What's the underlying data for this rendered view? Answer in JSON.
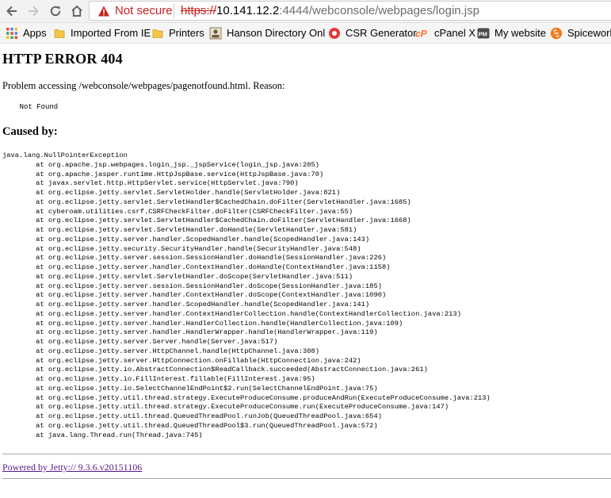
{
  "browser": {
    "security_label": "Not secure",
    "url": {
      "scheme": "https://",
      "host": "10.141.12.2",
      "rest": ":4444/webconsole/webpages/login.jsp"
    },
    "bookmarks": [
      {
        "label": "Apps",
        "icon": "apps-grid-icon"
      },
      {
        "label": "Imported From IE",
        "icon": "folder-icon"
      },
      {
        "label": "Printers",
        "icon": "folder-icon"
      },
      {
        "label": "Hanson Directory Onl",
        "icon": "directory-site-icon"
      },
      {
        "label": "CSR Generator",
        "icon": "csr-site-icon"
      },
      {
        "label": "cPanel X",
        "icon": "cpanel-icon"
      },
      {
        "label": "My website",
        "icon": "pm-site-icon"
      },
      {
        "label": "Spicework",
        "icon": "spiceworks-icon"
      }
    ]
  },
  "page": {
    "title": "HTTP ERROR 404",
    "problem": "Problem accessing /webconsole/webpages/pagenotfound.html. Reason:",
    "reason": "    Not Found",
    "caused_by": "Caused by:",
    "exception": "java.lang.NullPointerException",
    "stack": [
      "at org.apache.jsp.webpages.login_jsp._jspService(login_jsp.java:205)",
      "at org.apache.jasper.runtime.HttpJspBase.service(HttpJspBase.java:70)",
      "at javax.servlet.http.HttpServlet.service(HttpServlet.java:790)",
      "at org.eclipse.jetty.servlet.ServletHolder.handle(ServletHolder.java:821)",
      "at org.eclipse.jetty.servlet.ServletHandler$CachedChain.doFilter(ServletHandler.java:1685)",
      "at cyberoam.utilities.csrf.CSRFCheckFilter.doFilter(CSRFCheckFilter.java:55)",
      "at org.eclipse.jetty.servlet.ServletHandler$CachedChain.doFilter(ServletHandler.java:1668)",
      "at org.eclipse.jetty.servlet.ServletHandler.doHandle(ServletHandler.java:581)",
      "at org.eclipse.jetty.server.handler.ScopedHandler.handle(ScopedHandler.java:143)",
      "at org.eclipse.jetty.security.SecurityHandler.handle(SecurityHandler.java:548)",
      "at org.eclipse.jetty.server.session.SessionHandler.doHandle(SessionHandler.java:226)",
      "at org.eclipse.jetty.server.handler.ContextHandler.doHandle(ContextHandler.java:1158)",
      "at org.eclipse.jetty.servlet.ServletHandler.doScope(ServletHandler.java:511)",
      "at org.eclipse.jetty.server.session.SessionHandler.doScope(SessionHandler.java:185)",
      "at org.eclipse.jetty.server.handler.ContextHandler.doScope(ContextHandler.java:1090)",
      "at org.eclipse.jetty.server.handler.ScopedHandler.handle(ScopedHandler.java:141)",
      "at org.eclipse.jetty.server.handler.ContextHandlerCollection.handle(ContextHandlerCollection.java:213)",
      "at org.eclipse.jetty.server.handler.HandlerCollection.handle(HandlerCollection.java:109)",
      "at org.eclipse.jetty.server.handler.HandlerWrapper.handle(HandlerWrapper.java:119)",
      "at org.eclipse.jetty.server.Server.handle(Server.java:517)",
      "at org.eclipse.jetty.server.HttpChannel.handle(HttpChannel.java:308)",
      "at org.eclipse.jetty.server.HttpConnection.onFillable(HttpConnection.java:242)",
      "at org.eclipse.jetty.io.AbstractConnection$ReadCallback.succeeded(AbstractConnection.java:261)",
      "at org.eclipse.jetty.io.FillInterest.fillable(FillInterest.java:95)",
      "at org.eclipse.jetty.io.SelectChannelEndPoint$2.run(SelectChannelEndPoint.java:75)",
      "at org.eclipse.jetty.util.thread.strategy.ExecuteProduceConsume.produceAndRun(ExecuteProduceConsume.java:213)",
      "at org.eclipse.jetty.util.thread.strategy.ExecuteProduceConsume.run(ExecuteProduceConsume.java:147)",
      "at org.eclipse.jetty.util.thread.QueuedThreadPool.runJob(QueuedThreadPool.java:654)",
      "at org.eclipse.jetty.util.thread.QueuedThreadPool$3.run(QueuedThreadPool.java:572)",
      "at java.lang.Thread.run(Thread.java:745)"
    ],
    "powered_by": "Powered by Jetty:// 9.3.6.v20151106"
  },
  "colors": {
    "insecure": "#c5221f",
    "visited_link": "#551a8b"
  }
}
